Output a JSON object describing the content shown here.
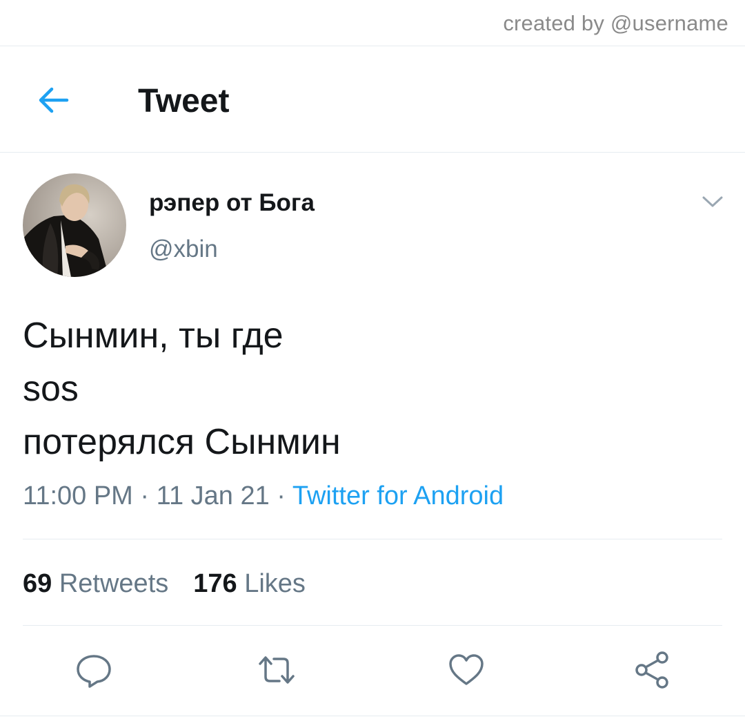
{
  "credit": {
    "text": "created by @username"
  },
  "header": {
    "title": "Tweet",
    "back_icon": "arrow-left-icon"
  },
  "tweet": {
    "author": {
      "display_name": "рэпер от Бога",
      "handle": "@xbin"
    },
    "text": "Сынмин, ты где\nsos\nпотерялся Сынмин",
    "time": "11:00 PM",
    "date": "11 Jan 21",
    "source": "Twitter for Android",
    "separator": " · ",
    "stats": {
      "retweets_count": "69",
      "retweets_label": "Retweets",
      "likes_count": "176",
      "likes_label": "Likes"
    }
  },
  "actions": [
    "reply-icon",
    "retweet-icon",
    "like-icon",
    "share-icon"
  ],
  "colors": {
    "accent": "#1da1f2",
    "text": "#14171a",
    "secondary": "#657786",
    "divider": "#e6ecf0",
    "icon": "#657786"
  }
}
